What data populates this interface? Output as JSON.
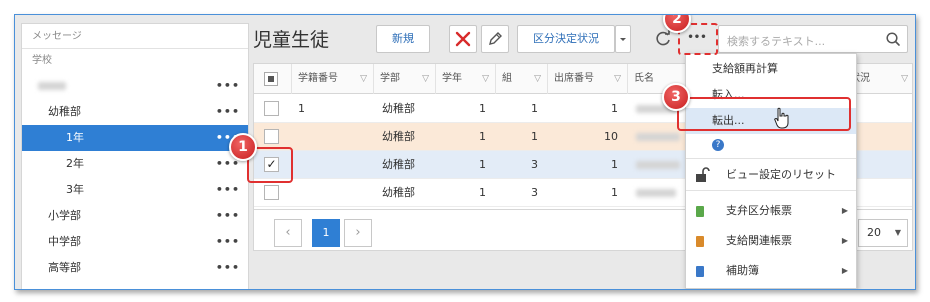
{
  "sidebar": {
    "header": "メッセージ",
    "section": "学校",
    "items": [
      {
        "label": "",
        "indent": 1
      },
      {
        "label": "幼稚部",
        "indent": 2
      },
      {
        "label": "1年",
        "indent": 3,
        "selected": true
      },
      {
        "label": "2年",
        "indent": 3
      },
      {
        "label": "3年",
        "indent": 3
      },
      {
        "label": "小学部",
        "indent": 1
      },
      {
        "label": "中学部",
        "indent": 1
      },
      {
        "label": "高等部",
        "indent": 1
      }
    ],
    "dots": "•••"
  },
  "main": {
    "title": "児童生徒",
    "new_button": "新規",
    "status_button": "区分決定状況",
    "search_placeholder": "検索するテキスト..."
  },
  "grid": {
    "columns": [
      "学籍番号",
      "学部",
      "学年",
      "組",
      "出席番号",
      "氏名",
      "状況"
    ],
    "rows": [
      {
        "student_id": "1",
        "dept": "幼稚部",
        "grade": "1",
        "class": "1",
        "attendance": "1",
        "checked": false
      },
      {
        "student_id": "",
        "dept": "幼稚部",
        "grade": "1",
        "class": "1",
        "attendance": "10",
        "checked": false
      },
      {
        "student_id": "",
        "dept": "幼稚部",
        "grade": "1",
        "class": "3",
        "attendance": "1",
        "checked": true
      },
      {
        "student_id": "",
        "dept": "幼稚部",
        "grade": "1",
        "class": "3",
        "attendance": "1",
        "checked": false
      }
    ],
    "page": "1",
    "page_size": "20"
  },
  "menu": {
    "items": [
      "支給額再計算",
      "転入...",
      "転出...",
      "?",
      "ビュー設定のリセット",
      "支弁区分帳票",
      "支給関連帳票",
      "補助簿"
    ]
  },
  "callouts": [
    "1",
    "2",
    "3"
  ],
  "colors": {
    "accent": "#2f7fd4",
    "callout": "#e03030",
    "link": "#2f6fb8"
  }
}
